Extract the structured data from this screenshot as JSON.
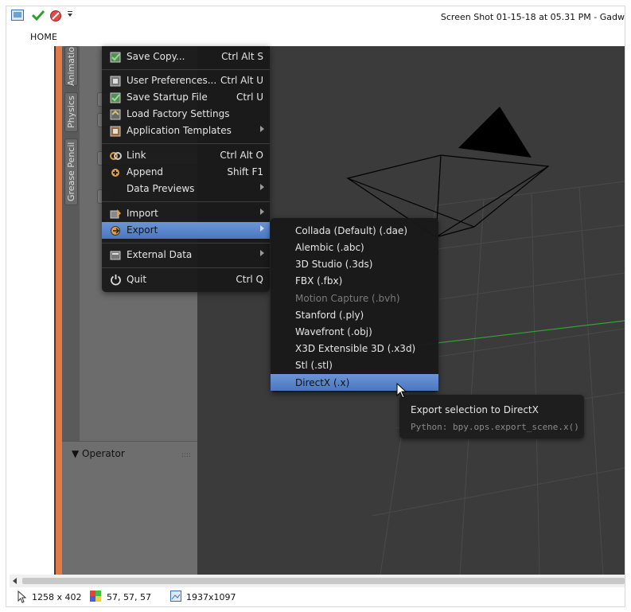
{
  "window": {
    "title": "Screen Shot 01-15-18 at 05.31 PM - Gadw"
  },
  "ribbon": {
    "tab_home": "HOME"
  },
  "sidebar_tabs": [
    "Animatio",
    "Physics",
    "Grease Pencil"
  ],
  "operator_panel": {
    "label": "▼ Operator"
  },
  "file_menu": {
    "items": [
      {
        "label": "Save Copy...",
        "shortcut": "Ctrl Alt S",
        "icon": "save-copy-icon"
      },
      {
        "label": "User Preferences...",
        "shortcut": "Ctrl Alt U",
        "icon": "preferences-icon"
      },
      {
        "label": "Save Startup File",
        "shortcut": "Ctrl U",
        "icon": "save-startup-icon"
      },
      {
        "label": "Load Factory Settings",
        "shortcut": "",
        "icon": "load-factory-icon"
      },
      {
        "label": "Application Templates",
        "shortcut": "",
        "icon": "templates-icon",
        "submenu": true
      },
      {
        "label": "Link",
        "shortcut": "Ctrl Alt O",
        "icon": "link-icon"
      },
      {
        "label": "Append",
        "shortcut": "Shift F1",
        "icon": "append-icon"
      },
      {
        "label": "Data Previews",
        "shortcut": "",
        "icon": "",
        "submenu": true
      },
      {
        "label": "Import",
        "shortcut": "",
        "icon": "import-icon",
        "submenu": true
      },
      {
        "label": "Export",
        "shortcut": "",
        "icon": "export-icon",
        "submenu": true
      },
      {
        "label": "External Data",
        "shortcut": "",
        "icon": "external-data-icon",
        "submenu": true
      },
      {
        "label": "Quit",
        "shortcut": "Ctrl Q",
        "icon": "power-icon"
      }
    ]
  },
  "export_menu": {
    "items": [
      {
        "label": "Collada (Default) (.dae)",
        "enabled": true
      },
      {
        "label": "Alembic (.abc)",
        "enabled": true
      },
      {
        "label": "3D Studio (.3ds)",
        "enabled": true
      },
      {
        "label": "FBX (.fbx)",
        "enabled": true
      },
      {
        "label": "Motion Capture (.bvh)",
        "enabled": false
      },
      {
        "label": "Stanford (.ply)",
        "enabled": true
      },
      {
        "label": "Wavefront (.obj)",
        "enabled": true
      },
      {
        "label": "X3D Extensible 3D (.x3d)",
        "enabled": true
      },
      {
        "label": "Stl (.stl)",
        "enabled": true
      },
      {
        "label": "DirectX (.x)",
        "enabled": true,
        "highlighted": true
      }
    ]
  },
  "tooltip": {
    "title": "Export selection to DirectX",
    "python": "Python: bpy.ops.export_scene.x()"
  },
  "statusbar": {
    "selection_size": "1258 x 402",
    "color_value": "57, 57, 57",
    "image_size": "1937x1097"
  },
  "colors": {
    "menu_highlight": "#5a86cc",
    "orange_strip": "#e07b45",
    "viewport_bg": "#3b3b3b",
    "grid_green": "#3aa03a"
  }
}
